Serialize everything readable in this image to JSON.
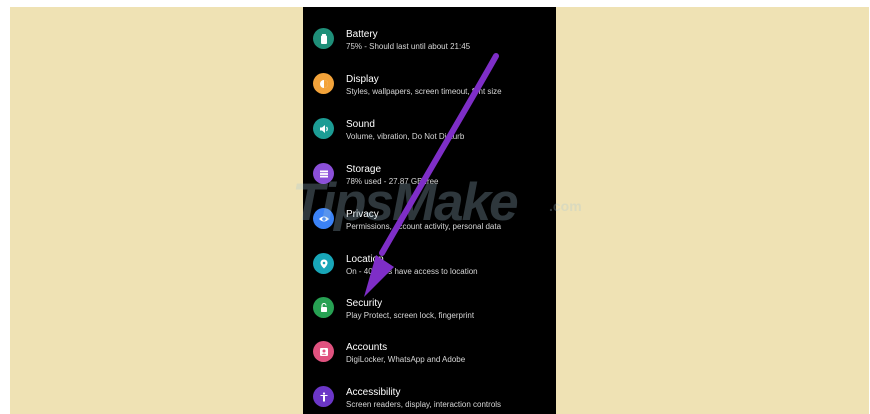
{
  "settings": {
    "items": [
      {
        "title": "Battery",
        "subtitle": "75% - Should last until about 21:45",
        "icon": "battery-icon",
        "color": "#1f8f79"
      },
      {
        "title": "Display",
        "subtitle": "Styles, wallpapers, screen timeout, font size",
        "icon": "display-icon",
        "color": "#f3a33a"
      },
      {
        "title": "Sound",
        "subtitle": "Volume, vibration, Do Not Disturb",
        "icon": "sound-icon",
        "color": "#1c9c94"
      },
      {
        "title": "Storage",
        "subtitle": "78% used - 27.87 GB free",
        "icon": "storage-icon",
        "color": "#8b4fd8"
      },
      {
        "title": "Privacy",
        "subtitle": "Permissions, account activity, personal data",
        "icon": "privacy-icon",
        "color": "#3b82f6"
      },
      {
        "title": "Location",
        "subtitle": "On - 40 apps have access to location",
        "icon": "location-icon",
        "color": "#18a6b8"
      },
      {
        "title": "Security",
        "subtitle": "Play Protect, screen lock, fingerprint",
        "icon": "security-icon",
        "color": "#27a153"
      },
      {
        "title": "Accounts",
        "subtitle": "DigiLocker, WhatsApp and Adobe",
        "icon": "accounts-icon",
        "color": "#e0527f"
      },
      {
        "title": "Accessibility",
        "subtitle": "Screen readers, display, interaction controls",
        "icon": "accessibility-icon",
        "color": "#6b36c7"
      }
    ]
  },
  "watermark": {
    "main": "TipsMake",
    "suffix": ".com"
  },
  "colors": {
    "background": "#efe2b4",
    "phone": "#000000",
    "arrow": "#7e2ec7"
  }
}
